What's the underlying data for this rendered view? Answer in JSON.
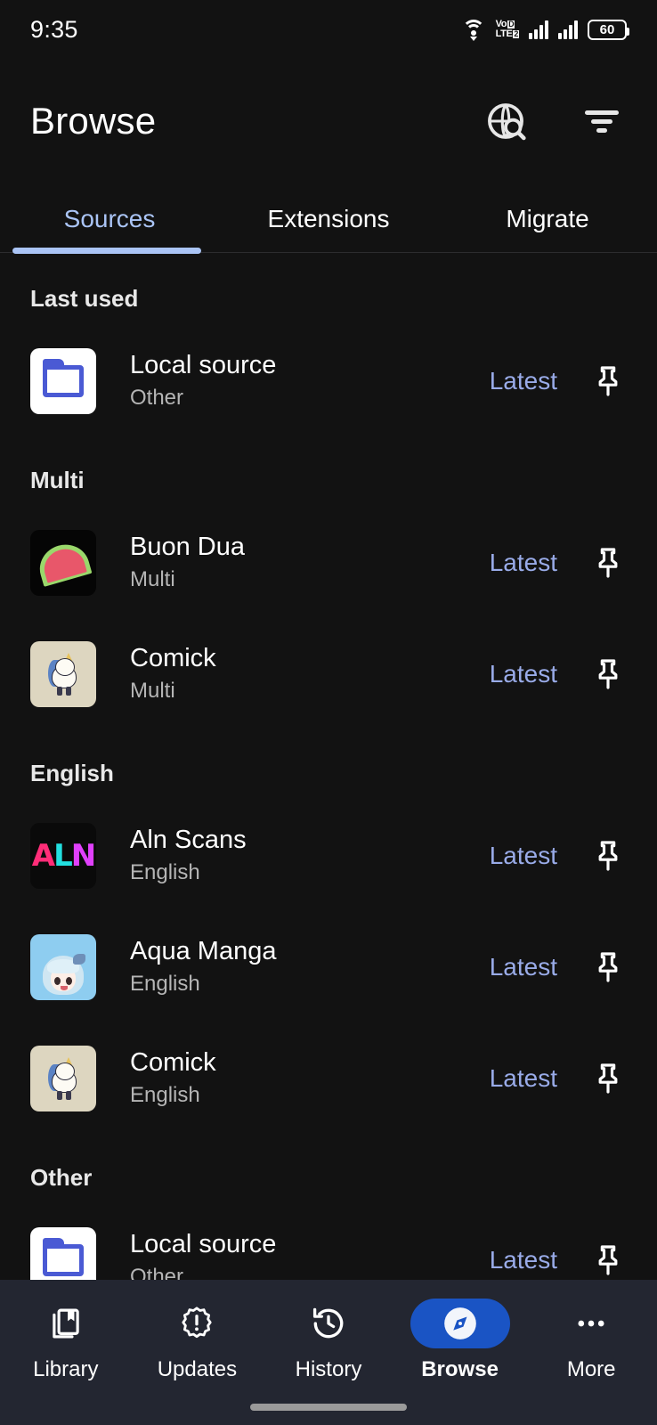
{
  "status_bar": {
    "time": "9:35",
    "wifi_icon": "wifi-icon",
    "network_label_top": "Vo",
    "network_label_top_badge": "D",
    "network_label_bottom": "LTE",
    "network_label_bottom_badge": "2",
    "signal_icon_1": "signal-bars-icon",
    "signal_icon_2": "signal-bars-icon",
    "battery_percent": "60"
  },
  "app_bar": {
    "title": "Browse",
    "global_search_icon": "globe-search-icon",
    "filter_icon": "filter-icon"
  },
  "tabs": {
    "items": [
      {
        "label": "Sources",
        "active": true
      },
      {
        "label": "Extensions",
        "active": false
      },
      {
        "label": "Migrate",
        "active": false
      }
    ]
  },
  "sections": [
    {
      "header": "Last used",
      "sources": [
        {
          "name": "Local source",
          "language": "Other",
          "action": "Latest",
          "icon": "local-source-icon",
          "pin_icon": "pin-icon"
        }
      ]
    },
    {
      "header": "Multi",
      "sources": [
        {
          "name": "Buon Dua",
          "language": "Multi",
          "action": "Latest",
          "icon": "watermelon-icon",
          "pin_icon": "pin-icon"
        },
        {
          "name": "Comick",
          "language": "Multi",
          "action": "Latest",
          "icon": "unicorn-icon",
          "pin_icon": "pin-icon"
        }
      ]
    },
    {
      "header": "English",
      "sources": [
        {
          "name": "Aln Scans",
          "language": "English",
          "action": "Latest",
          "icon": "aln-logo-icon",
          "pin_icon": "pin-icon"
        },
        {
          "name": "Aqua Manga",
          "language": "English",
          "action": "Latest",
          "icon": "aqua-character-icon",
          "pin_icon": "pin-icon"
        },
        {
          "name": "Comick",
          "language": "English",
          "action": "Latest",
          "icon": "unicorn-icon",
          "pin_icon": "pin-icon"
        }
      ]
    },
    {
      "header": "Other",
      "sources": [
        {
          "name": "Local source",
          "language": "Other",
          "action": "Latest",
          "icon": "local-source-icon",
          "pin_icon": "pin-icon"
        }
      ]
    }
  ],
  "bottom_nav": {
    "items": [
      {
        "label": "Library",
        "icon": "library-books-icon",
        "active": false
      },
      {
        "label": "Updates",
        "icon": "updates-alert-icon",
        "active": false
      },
      {
        "label": "History",
        "icon": "history-clock-icon",
        "active": false
      },
      {
        "label": "Browse",
        "icon": "compass-icon",
        "active": true
      },
      {
        "label": "More",
        "icon": "more-dots-icon",
        "active": false
      }
    ]
  },
  "colors": {
    "background": "#121212",
    "accent_blue": "#1a54c4",
    "tab_active": "#aac4f5",
    "link_blue": "#99abe8",
    "nav_background": "#232631"
  }
}
